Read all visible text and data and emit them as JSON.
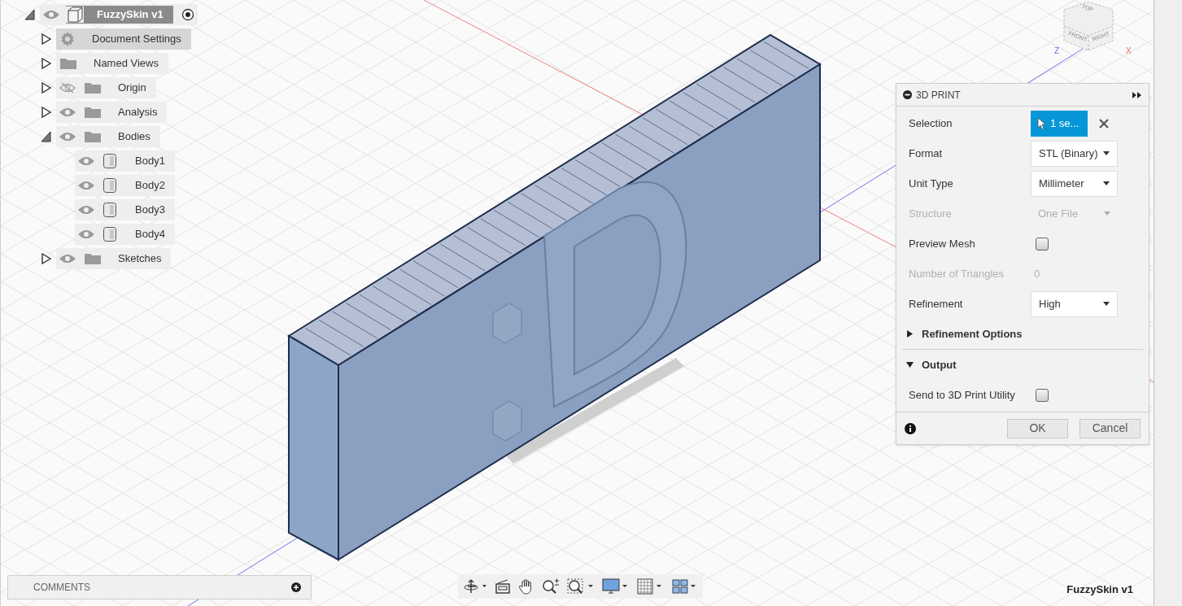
{
  "browser": {
    "root": {
      "label": "FuzzySkin v1",
      "expanded": true,
      "visible": true,
      "active": true
    },
    "items": [
      {
        "kind": "settings",
        "label": "Document Settings",
        "expanded": false
      },
      {
        "kind": "folder",
        "label": "Named Views",
        "expanded": false
      },
      {
        "kind": "folder",
        "label": "Origin",
        "expanded": false,
        "visible": false
      },
      {
        "kind": "folder",
        "label": "Analysis",
        "expanded": false,
        "visible": true
      },
      {
        "kind": "folder",
        "label": "Bodies",
        "expanded": true,
        "visible": true,
        "children": [
          {
            "kind": "body",
            "label": "Body1",
            "visible": true
          },
          {
            "kind": "body",
            "label": "Body2",
            "visible": true
          },
          {
            "kind": "body",
            "label": "Body3",
            "visible": true
          },
          {
            "kind": "body",
            "label": "Body4",
            "visible": true
          }
        ]
      },
      {
        "kind": "folder",
        "label": "Sketches",
        "expanded": false,
        "visible": true
      }
    ]
  },
  "view_cube": {
    "top": "TOP",
    "front": "FRONT",
    "right": "RIGHT",
    "axis_z": "Z",
    "axis_x": "X"
  },
  "print_panel": {
    "title": "3D PRINT",
    "rows": [
      {
        "kind": "selection",
        "label": "Selection",
        "value": "1 se...",
        "disabled": false
      },
      {
        "kind": "dropdown",
        "label": "Format",
        "value": "STL (Binary)",
        "disabled": false
      },
      {
        "kind": "dropdown",
        "label": "Unit Type",
        "value": "Millimeter",
        "disabled": false
      },
      {
        "kind": "dropdown",
        "label": "Structure",
        "value": "One File",
        "disabled": true
      },
      {
        "kind": "checkbox",
        "label": "Preview Mesh",
        "checked": false,
        "disabled": false
      },
      {
        "kind": "readout",
        "label": "Number of Triangles",
        "value": "0",
        "disabled": true
      },
      {
        "kind": "dropdown",
        "label": "Refinement",
        "value": "High",
        "disabled": false
      },
      {
        "kind": "section",
        "label": "Refinement Options",
        "expanded": false
      },
      {
        "kind": "divider"
      },
      {
        "kind": "section",
        "label": "Output",
        "expanded": true
      },
      {
        "kind": "checkbox",
        "label": "Send to 3D Print Utility",
        "checked": false,
        "disabled": false
      }
    ],
    "buttons": [
      "OK",
      "Cancel"
    ]
  },
  "comments": {
    "label": "COMMENTS"
  },
  "document_name": "FuzzySkin v1"
}
